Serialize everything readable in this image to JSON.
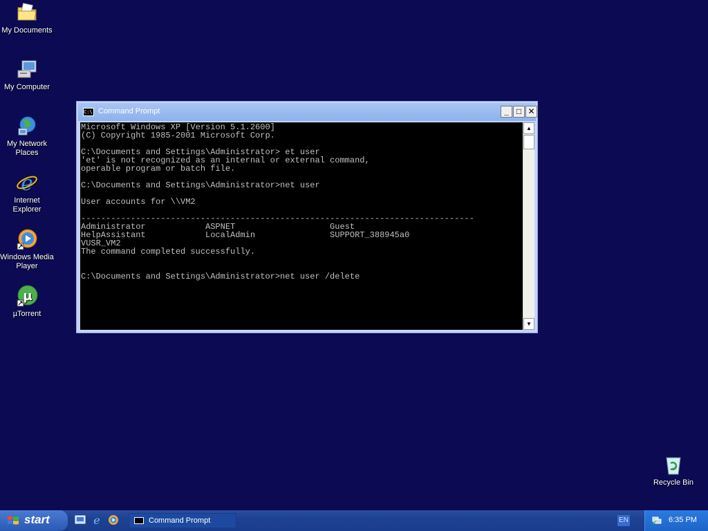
{
  "desktop": {
    "icons": [
      {
        "label": "My Documents",
        "icon": "folder-documents-icon"
      },
      {
        "label": "My Computer",
        "icon": "computer-icon"
      },
      {
        "label": "My Network Places",
        "icon": "network-places-icon"
      },
      {
        "label": "Internet Explorer",
        "icon": "internet-explorer-icon"
      },
      {
        "label": "Windows Media Player",
        "icon": "media-player-icon"
      },
      {
        "label": "µTorrent",
        "icon": "utorrent-icon"
      },
      {
        "label": "Recycle Bin",
        "icon": "recycle-bin-icon"
      }
    ]
  },
  "window": {
    "title": "Command Prompt",
    "minimize": "_",
    "maximize": "□",
    "close": "✕",
    "console_text": "Microsoft Windows XP [Version 5.1.2600]\n(C) Copyright 1985-2001 Microsoft Corp.\n\nC:\\Documents and Settings\\Administrator> et user\n'et' is not recognized as an internal or external command,\noperable program or batch file.\n\nC:\\Documents and Settings\\Administrator>net user\n\nUser accounts for \\\\VM2\n\n-------------------------------------------------------------------------------\nAdministrator            ASPNET                   Guest\nHelpAssistant            LocalAdmin               SUPPORT_388945a0\nVUSR_VM2\nThe command completed successfully.\n\n\nC:\\Documents and Settings\\Administrator>net user /delete"
  },
  "taskbar": {
    "start_label": "start",
    "task_button": "Command Prompt",
    "language": "EN",
    "clock": "6:35 PM"
  },
  "colors": {
    "desktop_bg": "#0b0a52",
    "taskbar": "#1e4292",
    "start_button": "#3b6fcf",
    "tray": "#1d64c8"
  }
}
